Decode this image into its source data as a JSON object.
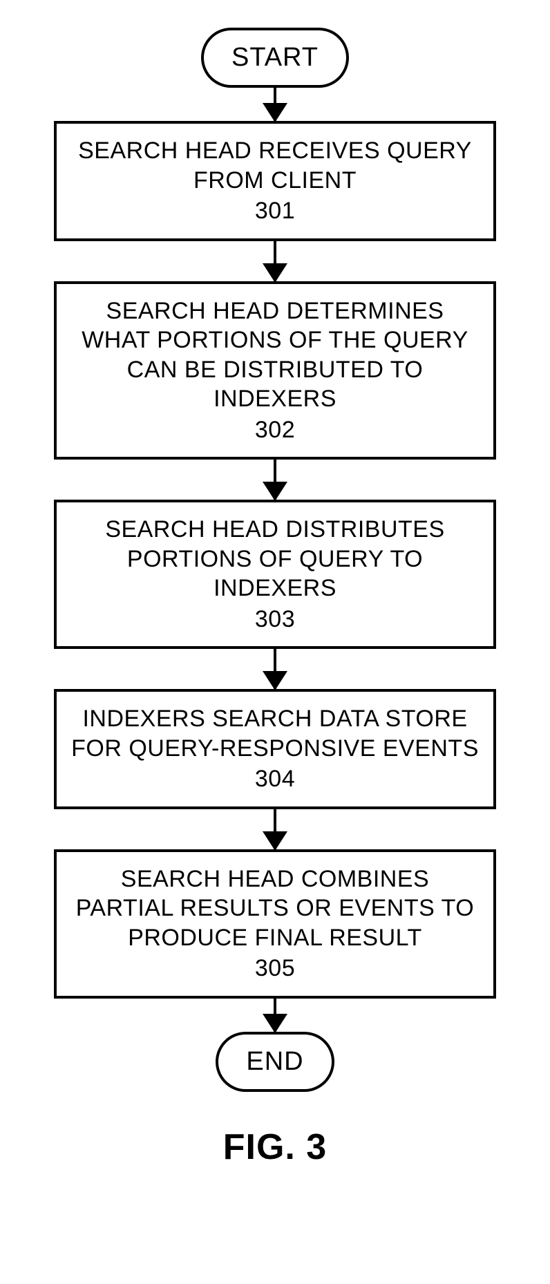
{
  "chart_data": {
    "type": "flowchart",
    "start": "START",
    "end": "END",
    "steps": [
      {
        "text": "SEARCH HEAD RECEIVES QUERY FROM CLIENT",
        "ref": "301"
      },
      {
        "text": "SEARCH HEAD DETERMINES WHAT PORTIONS OF THE QUERY CAN BE DISTRIBUTED TO INDEXERS",
        "ref": "302"
      },
      {
        "text": "SEARCH HEAD DISTRIBUTES PORTIONS OF QUERY TO INDEXERS",
        "ref": "303"
      },
      {
        "text": "INDEXERS SEARCH DATA STORE FOR QUERY-RESPONSIVE EVENTS",
        "ref": "304"
      },
      {
        "text": "SEARCH HEAD COMBINES PARTIAL RESULTS OR EVENTS TO PRODUCE FINAL RESULT",
        "ref": "305"
      }
    ],
    "caption": "FIG. 3"
  }
}
